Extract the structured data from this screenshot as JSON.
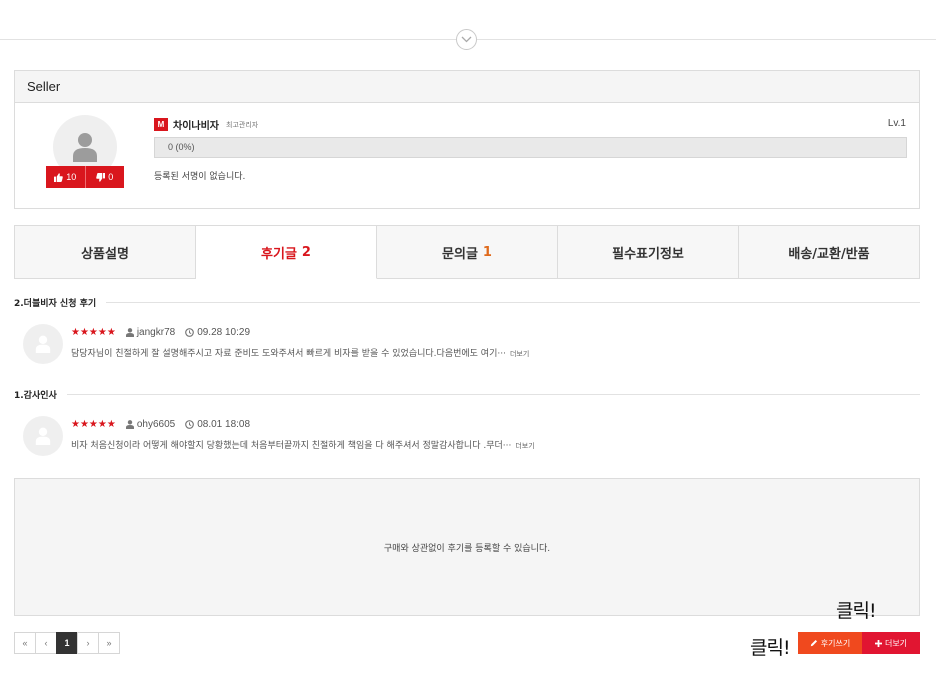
{
  "seller": {
    "header_title": "Seller",
    "badge": "M",
    "name": "차이나비자",
    "role": "최고관리자",
    "level": "Lv.1",
    "progress_text": "0 (0%)",
    "progress_fraction": 0,
    "like_count": "10",
    "dislike_count": "0",
    "signature": "등록된 서명이 없습니다."
  },
  "tabs": [
    {
      "label": "상품설명",
      "count": ""
    },
    {
      "label": "후기글",
      "count": "2"
    },
    {
      "label": "문의글",
      "count": "1"
    },
    {
      "label": "필수표기정보",
      "count": ""
    },
    {
      "label": "배송/교환/반품",
      "count": ""
    }
  ],
  "reviews": [
    {
      "title": "2.더블비자 신청 후기",
      "stars": "★★★★★",
      "author": "jangkr78",
      "date": "09.28 10:29",
      "text": "담당자님이 친절하게 잘 설명해주시고 자료 준비도 도와주셔서 빠르게 비자를 받을 수 있었습니다.다음번에도 여기···",
      "more": "더보기"
    },
    {
      "title": "1.감사인사",
      "stars": "★★★★★",
      "author": "ohy6605",
      "date": "08.01 18:08",
      "text": "비자 처음신청이라 어떻게 해야할지 당황했는데 처음부터끝까지 친절하게 책임을 다 해주셔서 정말감사합니다 .무더···",
      "more": "더보기"
    }
  ],
  "empty_notice": "구매와 상관없이 후기를 등록할 수 있습니다.",
  "pagination": {
    "first": "«",
    "prev": "‹",
    "current": "1",
    "next": "›",
    "last": "»"
  },
  "actions": {
    "write_label": "후기쓰기",
    "more_label": "더보기"
  },
  "annotations": {
    "click_top": "클릭!",
    "click_left": "클릭!"
  },
  "colors": {
    "accent_red": "#d9161d",
    "write_orange": "#f0491e",
    "more_red": "#e11531"
  },
  "icons": {
    "collapse": "chevron-down-icon",
    "avatar": "user-silhouette-icon",
    "like": "thumbs-up-icon",
    "dislike": "thumbs-down-icon",
    "author": "user-icon",
    "date": "clock-icon",
    "write": "pencil-icon",
    "more": "plus-icon"
  }
}
